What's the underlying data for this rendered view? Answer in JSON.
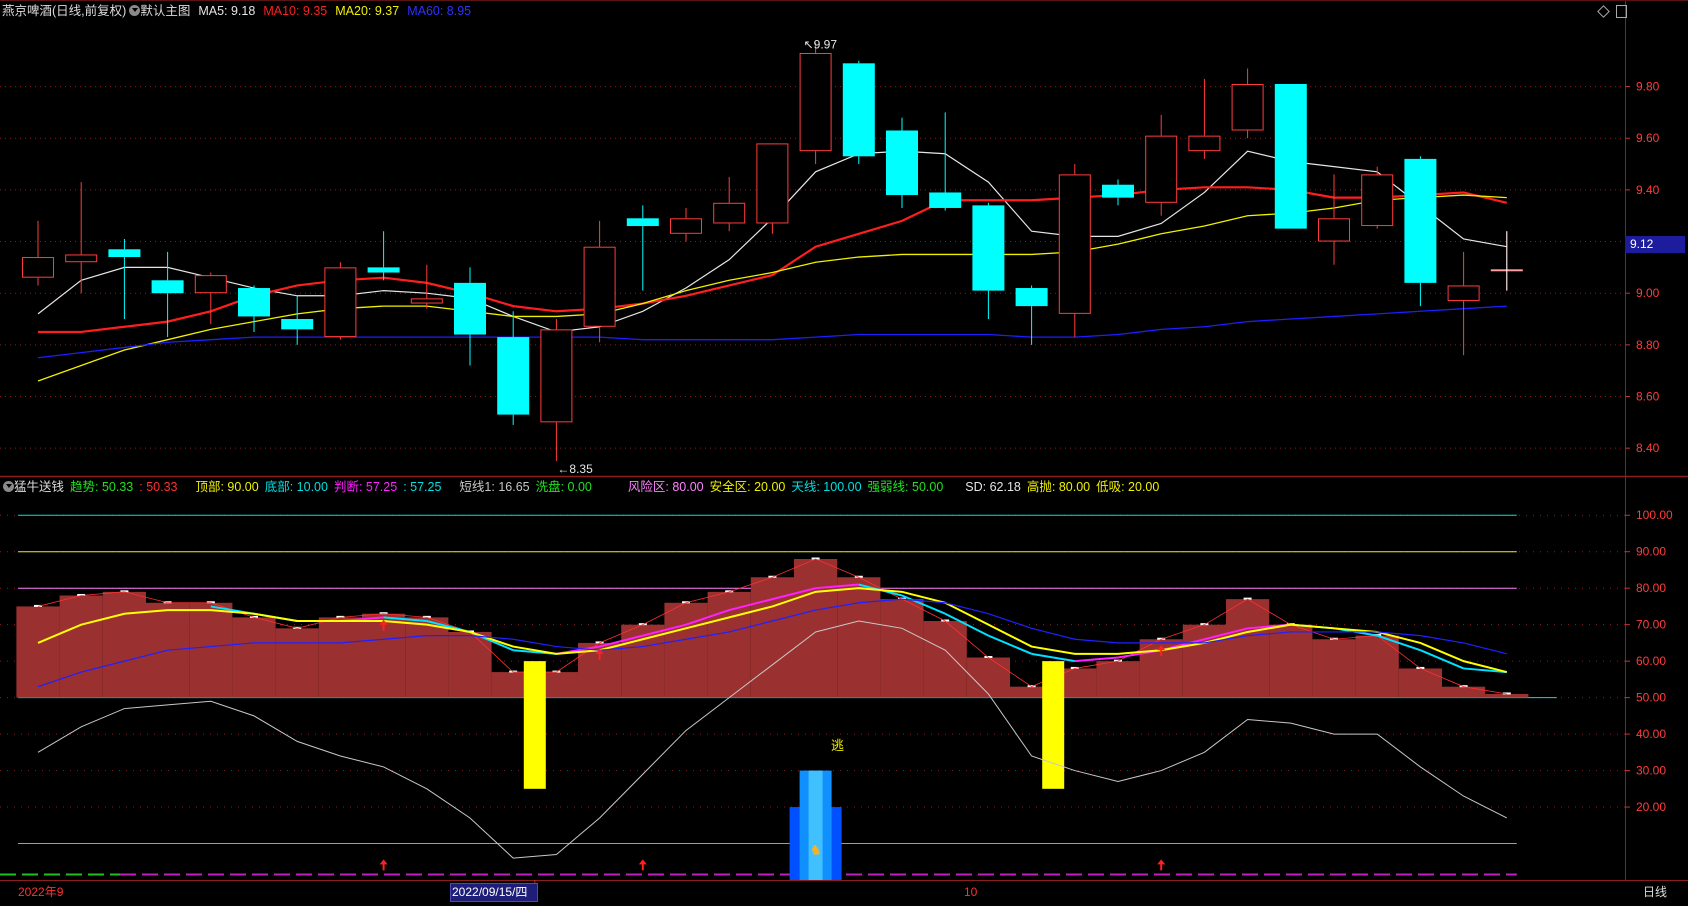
{
  "header_top": {
    "title": "燕京啤酒(日线,前复权)",
    "main_chart": "默认主图",
    "ma5": "MA5: 9.18",
    "ma10": "MA10: 9.35",
    "ma20": "MA20: 9.37",
    "ma60": "MA60: 8.95",
    "right_icon": "diamond-icon"
  },
  "header_bottom": {
    "indicator": "猛牛送钱",
    "trend": "趋势: 50.33",
    "trend2": ": 50.33",
    "top": "顶部: 90.00",
    "bottom": "底部: 10.00",
    "judge": "判断: 57.25",
    "judge2": ": 57.25",
    "short": "短线1: 16.65",
    "wash": "洗盘: 0.00",
    "risk": "风险区: 80.00",
    "safe": "安全区: 20.00",
    "sky": "天线: 100.00",
    "strength": "强弱线: 50.00",
    "sd": "SD: 62.18",
    "high_sell": "高抛: 80.00",
    "low_buy": "低吸: 20.00"
  },
  "axis": {
    "date_start": "2022年9",
    "date_selected": "2022/09/15/四",
    "date_month": "10",
    "period": "日线",
    "current_price_tag": "9.12",
    "escape_label": "逃"
  },
  "colors": {
    "up": "#ff3c3c",
    "down": "#00ffff",
    "ma5": "#e6e6e6",
    "ma10": "#ff1e1e",
    "ma20": "#f0f000",
    "ma60": "#1e1eff",
    "grid": "#8c1e1e",
    "tag": "#1c1c9c"
  },
  "chart_data": [
    {
      "type": "candlestick",
      "title": "燕京啤酒(日线,前复权)",
      "ylim": [
        8.3,
        10.05
      ],
      "yticks": [
        "9.80",
        "9.60",
        "9.40",
        "9.20",
        "9.00",
        "8.80",
        "8.60",
        "8.40"
      ],
      "annotations": {
        "high": "9.97",
        "low": "8.35"
      },
      "candles": [
        {
          "o": 9.06,
          "h": 9.28,
          "l": 9.03,
          "c": 9.14
        },
        {
          "o": 9.12,
          "h": 9.43,
          "l": 9.0,
          "c": 9.15
        },
        {
          "o": 9.17,
          "h": 9.21,
          "l": 8.9,
          "c": 9.14
        },
        {
          "o": 9.05,
          "h": 9.16,
          "l": 8.83,
          "c": 9.0
        },
        {
          "o": 9.0,
          "h": 9.08,
          "l": 8.88,
          "c": 9.07
        },
        {
          "o": 9.02,
          "h": 9.03,
          "l": 8.85,
          "c": 8.91
        },
        {
          "o": 8.9,
          "h": 8.99,
          "l": 8.8,
          "c": 8.86
        },
        {
          "o": 8.83,
          "h": 9.12,
          "l": 8.82,
          "c": 9.1
        },
        {
          "o": 9.1,
          "h": 9.24,
          "l": 9.05,
          "c": 9.08
        },
        {
          "o": 8.96,
          "h": 9.11,
          "l": 8.94,
          "c": 8.98
        },
        {
          "o": 9.04,
          "h": 9.1,
          "l": 8.72,
          "c": 8.84
        },
        {
          "o": 8.83,
          "h": 8.93,
          "l": 8.49,
          "c": 8.53
        },
        {
          "o": 8.5,
          "h": 8.9,
          "l": 8.35,
          "c": 8.86
        },
        {
          "o": 8.87,
          "h": 9.28,
          "l": 8.81,
          "c": 9.18
        },
        {
          "o": 9.29,
          "h": 9.34,
          "l": 9.01,
          "c": 9.26
        },
        {
          "o": 9.23,
          "h": 9.33,
          "l": 9.2,
          "c": 9.29
        },
        {
          "o": 9.27,
          "h": 9.45,
          "l": 9.24,
          "c": 9.35
        },
        {
          "o": 9.27,
          "h": 9.54,
          "l": 9.23,
          "c": 9.58
        },
        {
          "o": 9.55,
          "h": 9.97,
          "l": 9.5,
          "c": 9.93
        },
        {
          "o": 9.89,
          "h": 9.9,
          "l": 9.5,
          "c": 9.53
        },
        {
          "o": 9.63,
          "h": 9.68,
          "l": 9.33,
          "c": 9.38
        },
        {
          "o": 9.39,
          "h": 9.7,
          "l": 9.32,
          "c": 9.33
        },
        {
          "o": 9.34,
          "h": 9.35,
          "l": 8.9,
          "c": 9.01
        },
        {
          "o": 9.02,
          "h": 9.03,
          "l": 8.8,
          "c": 8.95
        },
        {
          "o": 8.92,
          "h": 9.5,
          "l": 8.83,
          "c": 9.46
        },
        {
          "o": 9.42,
          "h": 9.44,
          "l": 9.34,
          "c": 9.37
        },
        {
          "o": 9.35,
          "h": 9.69,
          "l": 9.3,
          "c": 9.61
        },
        {
          "o": 9.55,
          "h": 9.83,
          "l": 9.52,
          "c": 9.61
        },
        {
          "o": 9.63,
          "h": 9.87,
          "l": 9.6,
          "c": 9.81
        },
        {
          "o": 9.81,
          "h": 9.81,
          "l": 9.25,
          "c": 9.25
        },
        {
          "o": 9.2,
          "h": 9.46,
          "l": 9.11,
          "c": 9.29
        },
        {
          "o": 9.26,
          "h": 9.49,
          "l": 9.25,
          "c": 9.46
        },
        {
          "o": 9.52,
          "h": 9.53,
          "l": 8.95,
          "c": 9.04
        },
        {
          "o": 8.97,
          "h": 9.16,
          "l": 8.76,
          "c": 9.03
        },
        {
          "o": 9.09,
          "h": 9.24,
          "l": 9.01,
          "c": 9.09
        }
      ],
      "series": [
        {
          "name": "MA5",
          "values": [
            8.92,
            9.05,
            9.1,
            9.1,
            9.06,
            9.02,
            8.99,
            8.99,
            9.01,
            9.0,
            8.98,
            8.91,
            8.85,
            8.87,
            8.93,
            9.02,
            9.13,
            9.29,
            9.47,
            9.54,
            9.55,
            9.54,
            9.43,
            9.24,
            9.22,
            9.22,
            9.27,
            9.39,
            9.55,
            9.51,
            9.49,
            9.47,
            9.34,
            9.21,
            9.18
          ]
        },
        {
          "name": "MA10",
          "values": [
            8.85,
            8.85,
            8.87,
            8.89,
            8.93,
            8.99,
            9.03,
            9.05,
            9.06,
            9.04,
            9.0,
            8.95,
            8.93,
            8.94,
            8.96,
            8.99,
            9.03,
            9.07,
            9.18,
            9.23,
            9.28,
            9.36,
            9.36,
            9.36,
            9.37,
            9.38,
            9.4,
            9.41,
            9.41,
            9.4,
            9.37,
            9.37,
            9.38,
            9.39,
            9.35
          ]
        },
        {
          "name": "MA20",
          "values": [
            8.66,
            8.72,
            8.78,
            8.82,
            8.86,
            8.89,
            8.92,
            8.94,
            8.95,
            8.95,
            8.93,
            8.91,
            8.91,
            8.92,
            8.96,
            9.01,
            9.05,
            9.08,
            9.12,
            9.14,
            9.15,
            9.15,
            9.15,
            9.15,
            9.16,
            9.19,
            9.23,
            9.26,
            9.3,
            9.31,
            9.33,
            9.36,
            9.37,
            9.38,
            9.37
          ]
        },
        {
          "name": "MA60",
          "values": [
            8.75,
            8.77,
            8.79,
            8.81,
            8.82,
            8.83,
            8.83,
            8.83,
            8.83,
            8.83,
            8.83,
            8.83,
            8.83,
            8.83,
            8.82,
            8.82,
            8.82,
            8.82,
            8.83,
            8.84,
            8.84,
            8.84,
            8.84,
            8.83,
            8.83,
            8.84,
            8.86,
            8.87,
            8.89,
            8.9,
            8.91,
            8.92,
            8.93,
            8.94,
            8.95
          ]
        }
      ]
    },
    {
      "type": "bar",
      "title": "猛牛送钱",
      "ylim": [
        0,
        105
      ],
      "yticks": [
        "100.00",
        "90.00",
        "80.00",
        "70.00",
        "60.00",
        "50.00",
        "40.00",
        "30.00",
        "20.00"
      ],
      "hlines": [
        100,
        90,
        80,
        50,
        10
      ],
      "bars": [
        75,
        78,
        79,
        76,
        76,
        72,
        69,
        72,
        73,
        72,
        68,
        57,
        57,
        65,
        70,
        76,
        79,
        83,
        88,
        83,
        77,
        71,
        61,
        53,
        58,
        60,
        66,
        70,
        77,
        70,
        66,
        67,
        58,
        53,
        51
      ],
      "series": [
        {
          "name": "判断",
          "values": [
            null,
            null,
            null,
            null,
            75,
            73,
            71,
            71,
            72,
            71,
            68,
            63,
            62,
            64,
            67,
            70,
            74,
            77,
            80,
            81,
            78,
            73,
            67,
            62,
            60,
            61,
            63,
            66,
            69,
            70,
            69,
            67,
            63,
            58,
            57
          ]
        },
        {
          "name": "趋势",
          "values": [
            65,
            70,
            73,
            74,
            74,
            73,
            71,
            71,
            71,
            70,
            68,
            64,
            62,
            63,
            66,
            69,
            72,
            75,
            79,
            80,
            79,
            76,
            70,
            64,
            62,
            62,
            63,
            65,
            68,
            70,
            69,
            68,
            65,
            60,
            57
          ]
        },
        {
          "name": "MA",
          "values": [
            53,
            57,
            60,
            63,
            64,
            65,
            65,
            65,
            66,
            67,
            67,
            66,
            64,
            63,
            64,
            66,
            68,
            71,
            74,
            76,
            77,
            76,
            73,
            69,
            66,
            65,
            65,
            65,
            67,
            68,
            68,
            68,
            67,
            65,
            62
          ]
        },
        {
          "name": "短线1",
          "values": [
            35,
            42,
            47,
            48,
            49,
            45,
            38,
            34,
            31,
            25,
            17,
            6,
            7,
            17,
            29,
            41,
            50,
            59,
            68,
            71,
            69,
            63,
            51,
            34,
            30,
            27,
            30,
            35,
            44,
            43,
            40,
            40,
            31,
            23,
            17
          ]
        }
      ],
      "wash_signals": [
        11.5,
        23.5
      ],
      "escape_signal": {
        "index": 18,
        "label": "逃"
      },
      "buy_arrows": [
        8,
        13,
        26
      ],
      "low_arrows": [
        8,
        14,
        26
      ]
    }
  ]
}
